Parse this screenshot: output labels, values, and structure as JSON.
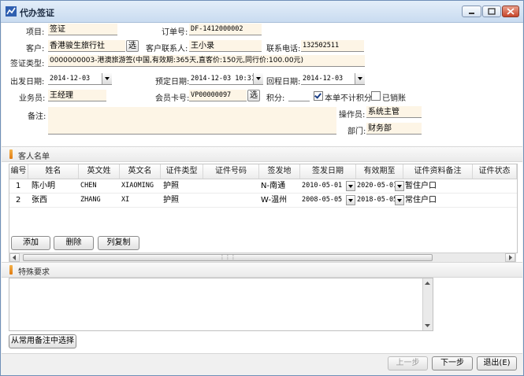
{
  "window": {
    "title": "代办签证"
  },
  "form": {
    "project_label": "项目:",
    "project_value": "签证",
    "order_label": "订单号:",
    "order_value": "DF-1412000002",
    "customer_label": "客户:",
    "customer_value": "香港骏生旅行社",
    "select_label": "选",
    "contact_label": "客户联系人:",
    "contact_value": "王小录",
    "phone_label": "联系电话:",
    "phone_value": "132502511",
    "visa_type_label": "签证类型:",
    "visa_type_value": "0000000003-港澳旅游签(中国,有效期:365天,直客价:150元,同行价:100.00元)",
    "depart_label": "出发日期:",
    "depart_value": "2014-12-03",
    "booking_label": "预定日期:",
    "booking_value": "2014-12-03 10:31",
    "return_label": "回程日期:",
    "return_value": "2014-12-03",
    "staff_label": "业务员:",
    "staff_value": "王经理",
    "member_label": "会员卡号:",
    "member_value": "VP00000097",
    "points_label": "积分:",
    "points_value": "",
    "no_points_label": "本单不计积分",
    "cancelled_label": "已销账",
    "remark_label": "备注:",
    "remark_value": "",
    "operator_label": "操作员:",
    "operator_value": "系统主管",
    "dept_label": "部门:",
    "dept_value": "财务部"
  },
  "guest_section": {
    "title": "客人名单"
  },
  "guest_table": {
    "columns": [
      "编号",
      "姓名",
      "英文姓",
      "英文名",
      "证件类型",
      "证件号码",
      "签发地",
      "签发日期",
      "有效期至",
      "证件资料备注",
      "证件状态"
    ],
    "rows": [
      {
        "no": "1",
        "name": "陈小明",
        "en_last": "CHEN",
        "en_first": "XIAOMING",
        "doc_type": "护照",
        "doc_no": "",
        "issue_place": "N-南通",
        "issue_date": "2010-05-01",
        "expiry": "2020-05-01",
        "remark": "暂住户口",
        "status": ""
      },
      {
        "no": "2",
        "name": "张西",
        "en_last": "ZHANG",
        "en_first": "XI",
        "doc_type": "护照",
        "doc_no": "",
        "issue_place": "W-温州",
        "issue_date": "2008-05-05",
        "expiry": "2018-05-05",
        "remark": "常住户口",
        "status": ""
      }
    ]
  },
  "grid_buttons": {
    "add": "添加",
    "delete": "删除",
    "copy": "列复制"
  },
  "special_section": {
    "title": "特殊要求"
  },
  "special_value": "",
  "choose_remark": "从常用备注中选择",
  "nav": {
    "prev": "上一步",
    "next": "下一步",
    "exit": "退出(E)"
  },
  "colors": {
    "field_bg": "#fdf5e6",
    "title_bg": "#c9dbf0",
    "accent": "#e07b12"
  }
}
